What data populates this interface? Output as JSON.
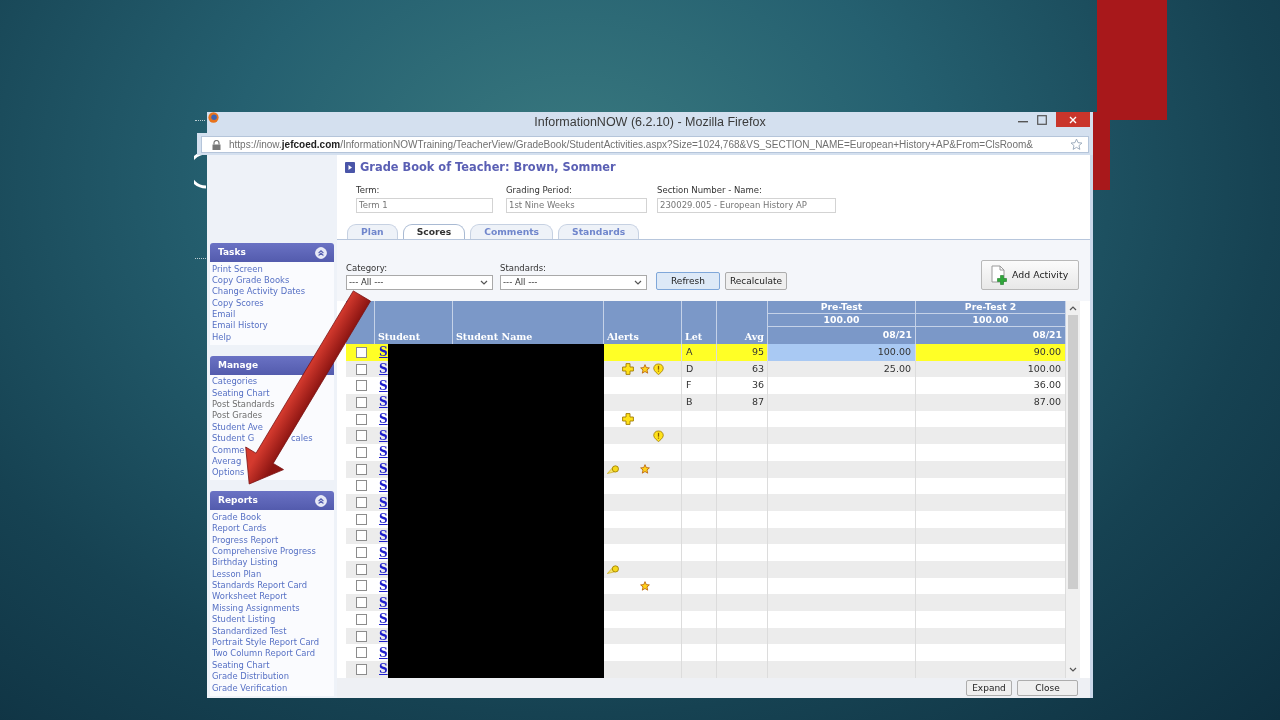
{
  "window": {
    "title": "InformationNOW (6.2.10) - Mozilla Firefox"
  },
  "address_bar": {
    "url": "https://inow.**jefcoed.com**/InformationNOWTraining/TeacherView/GradeBook/StudentActivities.aspx?Size=1024,768&VS_SECTION_NAME=European+History+AP&From=ClsRoom&"
  },
  "sidebar": {
    "sections": [
      {
        "title": "Tasks",
        "collapse_icon": true,
        "items": [
          {
            "label": "Print Screen",
            "disabled": false
          },
          {
            "label": "Copy Grade Books",
            "disabled": false
          },
          {
            "label": "Change Activity Dates",
            "disabled": false
          },
          {
            "label": "Copy Scores",
            "disabled": false
          },
          {
            "label": "Email",
            "disabled": false
          },
          {
            "label": "Email History",
            "disabled": false
          },
          {
            "label": "Help",
            "disabled": false
          }
        ]
      },
      {
        "title": "Manage",
        "collapse_icon": false,
        "items": [
          {
            "label": "Categories",
            "disabled": false
          },
          {
            "label": "Seating Chart",
            "disabled": false
          },
          {
            "label": "Post Standards",
            "disabled": true
          },
          {
            "label": "Post Grades",
            "disabled": true
          },
          {
            "label": "Student Ave",
            "disabled": false
          },
          {
            "label": "Student G",
            "label_tail": "cales",
            "disabled": false
          },
          {
            "label": "Comme",
            "disabled": false
          },
          {
            "label": "Averag",
            "disabled": false
          },
          {
            "label": "Options",
            "disabled": false
          }
        ]
      },
      {
        "title": "Reports",
        "collapse_icon": true,
        "items": [
          {
            "label": "Grade Book",
            "disabled": false
          },
          {
            "label": "Report Cards",
            "disabled": false
          },
          {
            "label": "Progress Report",
            "disabled": false
          },
          {
            "label": "Comprehensive Progress",
            "disabled": false
          },
          {
            "label": "Birthday Listing",
            "disabled": false
          },
          {
            "label": "Lesson Plan",
            "disabled": false
          },
          {
            "label": "Standards Report Card",
            "disabled": false
          },
          {
            "label": "Worksheet Report",
            "disabled": false
          },
          {
            "label": "Missing Assignments",
            "disabled": false
          },
          {
            "label": "Student Listing",
            "disabled": false
          },
          {
            "label": "Standardized Test",
            "disabled": false
          },
          {
            "label": "Portrait Style Report Card",
            "disabled": false
          },
          {
            "label": "Two Column Report Card",
            "disabled": false
          },
          {
            "label": "Seating Chart",
            "disabled": false
          },
          {
            "label": "Grade Distribution",
            "disabled": false
          },
          {
            "label": "Grade Verification",
            "disabled": false
          }
        ]
      }
    ]
  },
  "page": {
    "title": "Grade Book of Teacher: Brown, Sommer",
    "fields": [
      {
        "label": "Term:",
        "value": "Term 1"
      },
      {
        "label": "Grading Period:",
        "value": "1st Nine Weeks"
      },
      {
        "label": "Section Number - Name:",
        "value": "230029.005 - European History AP"
      }
    ],
    "tabs": [
      {
        "label": "Plan",
        "selected": false
      },
      {
        "label": "Scores",
        "selected": true
      },
      {
        "label": "Comments",
        "selected": false
      },
      {
        "label": "Standards",
        "selected": false
      }
    ]
  },
  "filters": [
    {
      "label": "Category:",
      "value": "--- All ---"
    },
    {
      "label": "Standards:",
      "value": "--- All ---"
    }
  ],
  "toolbar_buttons": [
    {
      "label": "Refresh",
      "focused": true
    },
    {
      "label": "Recalculate",
      "focused": false
    }
  ],
  "add_activity_button": {
    "label": "Add Activity"
  },
  "table": {
    "columns": [
      {
        "label": "Student"
      },
      {
        "label": "Student Name"
      },
      {
        "label": "Alerts"
      },
      {
        "label": "Let"
      },
      {
        "label": "Avg"
      }
    ],
    "activities": [
      {
        "name": "Pre-Test",
        "points": "100.00",
        "date": "08/21"
      },
      {
        "name": "Pre-Test 2",
        "points": "100.00",
        "date": "08/21"
      }
    ],
    "rows": [
      {
        "selected": true,
        "checked": false,
        "student": "S",
        "letter": "A",
        "avg": "95",
        "scores": [
          {
            "value": "100.00",
            "selected": true
          },
          {
            "value": "90.00",
            "selected": false
          }
        ]
      },
      {
        "selected": false,
        "checked": false,
        "student": "S",
        "alerts": [
          {
            "kind": "plus"
          },
          {
            "kind": "star"
          },
          {
            "kind": "bubble"
          }
        ],
        "letter": "D",
        "avg": "63",
        "scores": [
          {
            "value": "25.00",
            "selected": false
          },
          {
            "value": "100.00",
            "selected": false
          }
        ]
      },
      {
        "selected": false,
        "checked": false,
        "student": "S",
        "letter": "F",
        "avg": "36",
        "scores": [
          {
            "selected": false
          },
          {
            "value": "36.00",
            "selected": false
          }
        ]
      },
      {
        "selected": false,
        "checked": false,
        "student": "S",
        "letter": "B",
        "avg": "87",
        "scores": [
          {
            "selected": false
          },
          {
            "value": "87.00",
            "selected": false
          }
        ]
      },
      {
        "selected": false,
        "checked": false,
        "student": "S",
        "alerts": [
          {
            "kind": "plus"
          }
        ],
        "scores": [
          {
            "selected": false
          },
          {
            "selected": false
          }
        ]
      },
      {
        "selected": false,
        "checked": false,
        "student": "S",
        "alerts": [
          {
            "kind": "bubble"
          }
        ],
        "scores": [
          {
            "selected": false
          },
          {
            "selected": false
          }
        ]
      },
      {
        "selected": false,
        "checked": false,
        "student": "S",
        "scores": [
          {
            "selected": false
          },
          {
            "selected": false
          }
        ]
      },
      {
        "selected": false,
        "checked": false,
        "student": "S",
        "alerts": [
          {
            "kind": "comet"
          },
          {
            "kind": "star"
          }
        ],
        "scores": [
          {
            "selected": false
          },
          {
            "selected": false
          }
        ]
      },
      {
        "selected": false,
        "checked": false,
        "student": "S",
        "scores": [
          {
            "selected": false
          },
          {
            "selected": false
          }
        ]
      },
      {
        "selected": false,
        "checked": false,
        "student": "S",
        "scores": [
          {
            "selected": false
          },
          {
            "selected": false
          }
        ]
      },
      {
        "selected": false,
        "checked": false,
        "student": "S",
        "scores": [
          {
            "selected": false
          },
          {
            "selected": false
          }
        ]
      },
      {
        "selected": false,
        "checked": false,
        "student": "S",
        "scores": [
          {
            "selected": false
          },
          {
            "selected": false
          }
        ]
      },
      {
        "selected": false,
        "checked": false,
        "student": "S",
        "scores": [
          {
            "selected": false
          },
          {
            "selected": false
          }
        ]
      },
      {
        "selected": false,
        "checked": false,
        "student": "S",
        "alerts": [
          {
            "kind": "comet"
          }
        ],
        "scores": [
          {
            "selected": false
          },
          {
            "selected": false
          }
        ]
      },
      {
        "selected": false,
        "checked": false,
        "student": "S",
        "alerts": [
          {
            "kind": "star"
          }
        ],
        "scores": [
          {
            "selected": false
          },
          {
            "selected": false
          }
        ]
      },
      {
        "selected": false,
        "checked": false,
        "student": "S",
        "scores": [
          {
            "selected": false
          },
          {
            "selected": false
          }
        ]
      },
      {
        "selected": false,
        "checked": false,
        "student": "S",
        "scores": [
          {
            "selected": false
          },
          {
            "selected": false
          }
        ]
      },
      {
        "selected": false,
        "checked": false,
        "student": "S",
        "scores": [
          {
            "selected": false
          },
          {
            "selected": false
          }
        ]
      },
      {
        "selected": false,
        "checked": false,
        "student": "S",
        "scores": [
          {
            "selected": false
          },
          {
            "selected": false
          }
        ]
      },
      {
        "selected": false,
        "checked": false,
        "student": "S",
        "scores": [
          {
            "selected": false
          },
          {
            "selected": false
          }
        ]
      }
    ]
  },
  "footer_buttons": [
    {
      "label": "Expand"
    },
    {
      "label": "Close"
    }
  ]
}
